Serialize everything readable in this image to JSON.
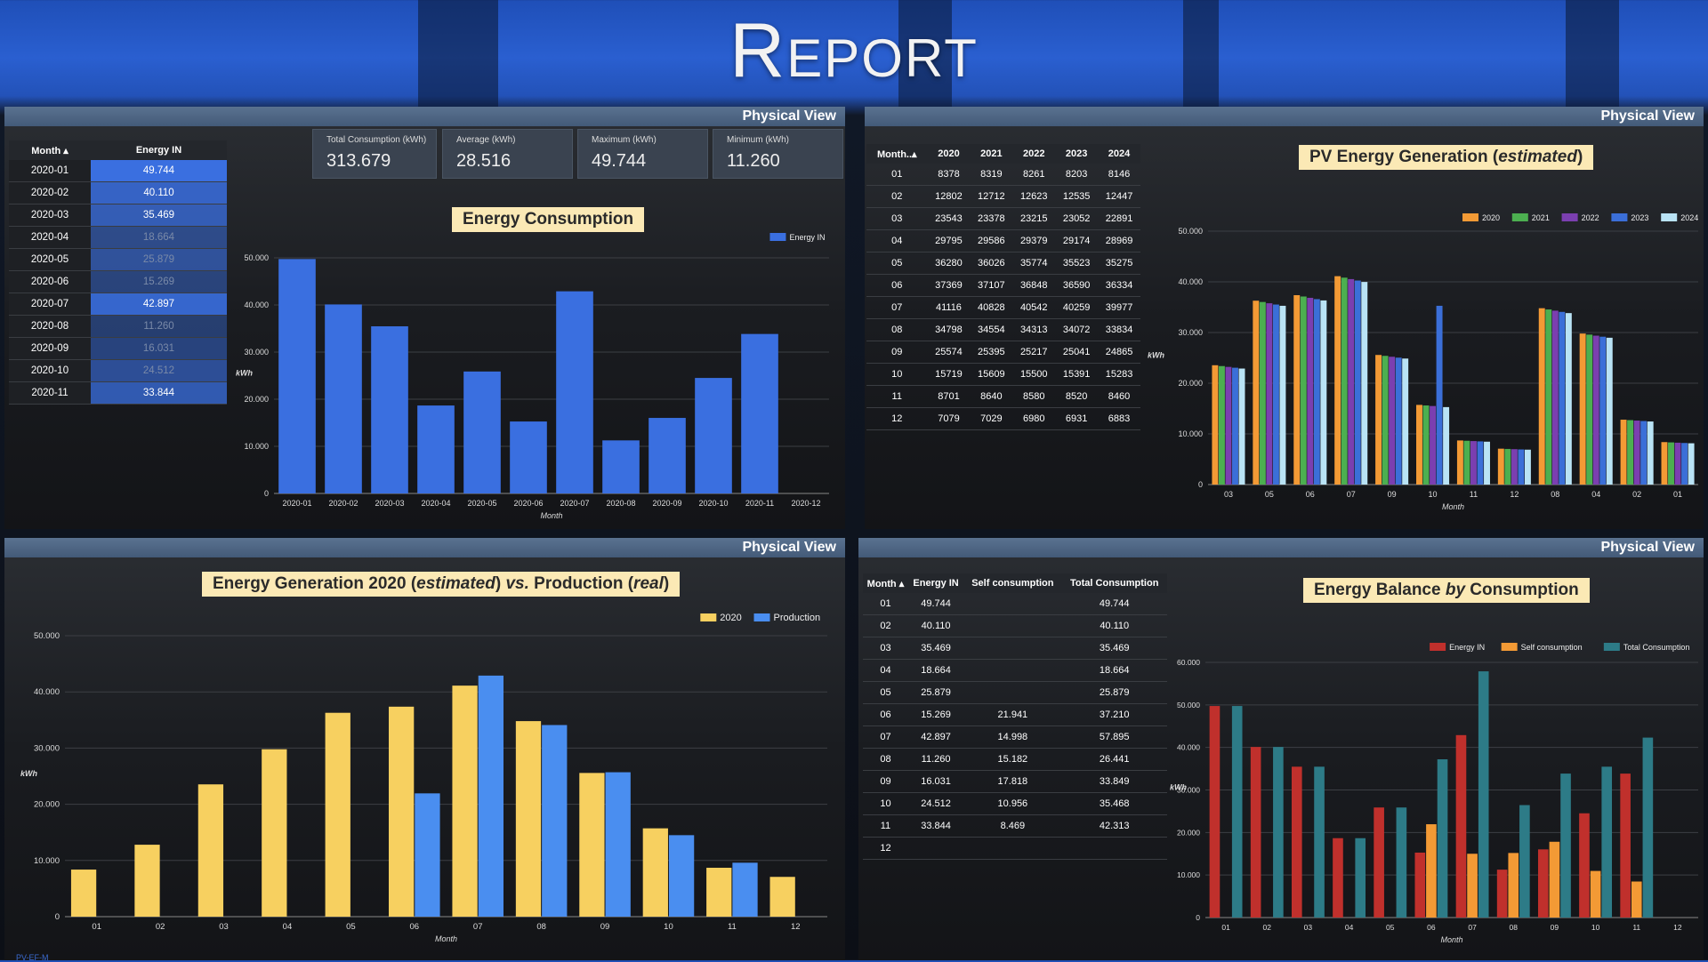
{
  "header": {
    "title": "Report"
  },
  "panel_label": "Physical View",
  "footnote": "PV-EF-M",
  "colors": {
    "accent_blue": "#3a6fe0",
    "yellow": "#f7d060",
    "red": "#c0302c",
    "orange": "#f39a35",
    "teal": "#2d7b87"
  },
  "panel1": {
    "table": {
      "headers": [
        "Month",
        "Energy IN"
      ],
      "rows": [
        {
          "month": "2020-01",
          "value": "49.744",
          "level": 0.995
        },
        {
          "month": "2020-02",
          "value": "40.110",
          "level": 0.8
        },
        {
          "month": "2020-03",
          "value": "35.469",
          "level": 0.7
        },
        {
          "month": "2020-04",
          "value": "18.664",
          "level": 0.37
        },
        {
          "month": "2020-05",
          "value": "25.879",
          "level": 0.5
        },
        {
          "month": "2020-06",
          "value": "15.269",
          "level": 0.3
        },
        {
          "month": "2020-07",
          "value": "42.897",
          "level": 0.86
        },
        {
          "month": "2020-08",
          "value": "11.260",
          "level": 0.22
        },
        {
          "month": "2020-09",
          "value": "16.031",
          "level": 0.32
        },
        {
          "month": "2020-10",
          "value": "24.512",
          "level": 0.49
        },
        {
          "month": "2020-11",
          "value": "33.844",
          "level": 0.68
        }
      ]
    },
    "scorecards": [
      {
        "label": "Total Consumption (kWh)",
        "value": "313.679"
      },
      {
        "label": "Average (kWh)",
        "value": "28.516"
      },
      {
        "label": "Maximum (kWh)",
        "value": "49.744"
      },
      {
        "label": "Minimum (kWh)",
        "value": "11.260"
      }
    ],
    "chart_title": "Energy Consumption"
  },
  "panel2": {
    "table": {
      "headers": [
        "Month",
        "2020",
        "2021",
        "2022",
        "2023",
        "2024"
      ],
      "rows": [
        [
          "01",
          "8378",
          "8319",
          "8261",
          "8203",
          "8146"
        ],
        [
          "02",
          "12802",
          "12712",
          "12623",
          "12535",
          "12447"
        ],
        [
          "03",
          "23543",
          "23378",
          "23215",
          "23052",
          "22891"
        ],
        [
          "04",
          "29795",
          "29586",
          "29379",
          "29174",
          "28969"
        ],
        [
          "05",
          "36280",
          "36026",
          "35774",
          "35523",
          "35275"
        ],
        [
          "06",
          "37369",
          "37107",
          "36848",
          "36590",
          "36334"
        ],
        [
          "07",
          "41116",
          "40828",
          "40542",
          "40259",
          "39977"
        ],
        [
          "08",
          "34798",
          "34554",
          "34313",
          "34072",
          "33834"
        ],
        [
          "09",
          "25574",
          "25395",
          "25217",
          "25041",
          "24865"
        ],
        [
          "10",
          "15719",
          "15609",
          "15500",
          "15391",
          "15283"
        ],
        [
          "11",
          "8701",
          "8640",
          "8580",
          "8520",
          "8460"
        ],
        [
          "12",
          "7079",
          "7029",
          "6980",
          "6931",
          "6883"
        ]
      ]
    },
    "chart_title_main": "PV Energy Generation (",
    "chart_title_em": "estimated",
    "chart_title_end": ")"
  },
  "panel3": {
    "chart_title_a": "Energy Generation 2020 (",
    "chart_title_em1": "estimated",
    "chart_title_b": ") ",
    "chart_title_vs": "vs.",
    "chart_title_c": " Production (",
    "chart_title_em2": "real",
    "chart_title_d": ")"
  },
  "panel4": {
    "table": {
      "headers": [
        "Month",
        "Energy IN",
        "Self consumption",
        "Total Consumption"
      ],
      "rows": [
        [
          "01",
          "49.744",
          "",
          "49.744"
        ],
        [
          "02",
          "40.110",
          "",
          "40.110"
        ],
        [
          "03",
          "35.469",
          "",
          "35.469"
        ],
        [
          "04",
          "18.664",
          "",
          "18.664"
        ],
        [
          "05",
          "25.879",
          "",
          "25.879"
        ],
        [
          "06",
          "15.269",
          "21.941",
          "37.210"
        ],
        [
          "07",
          "42.897",
          "14.998",
          "57.895"
        ],
        [
          "08",
          "11.260",
          "15.182",
          "26.441"
        ],
        [
          "09",
          "16.031",
          "17.818",
          "33.849"
        ],
        [
          "10",
          "24.512",
          "10.956",
          "35.468"
        ],
        [
          "11",
          "33.844",
          "8.469",
          "42.313"
        ],
        [
          "12",
          "",
          "",
          ""
        ]
      ]
    },
    "chart_title_a": "Energy Balance ",
    "chart_title_em": "by",
    "chart_title_b": " Consumption"
  },
  "chart_data": [
    {
      "type": "bar",
      "title": "Energy Consumption",
      "xlabel": "Month",
      "ylabel": "kWh",
      "ylim": [
        0,
        50000
      ],
      "yticks": [
        "0",
        "10.000",
        "20.000",
        "30.000",
        "40.000",
        "50.000"
      ],
      "categories": [
        "2020-01",
        "2020-02",
        "2020-03",
        "2020-04",
        "2020-05",
        "2020-06",
        "2020-07",
        "2020-08",
        "2020-09",
        "2020-10",
        "2020-11",
        "2020-12"
      ],
      "series": [
        {
          "name": "Energy IN",
          "color": "#3a6fe0",
          "values": [
            49744,
            40110,
            35469,
            18664,
            25879,
            15269,
            42897,
            11260,
            16031,
            24512,
            33844,
            null
          ]
        }
      ],
      "legend": "top-right",
      "grid": true
    },
    {
      "type": "bar",
      "title": "PV Energy Generation (estimated)",
      "xlabel": "Month",
      "ylabel": "kWh",
      "ylim": [
        0,
        50000
      ],
      "yticks": [
        "0",
        "10.000",
        "20.000",
        "30.000",
        "40.000",
        "50.000"
      ],
      "categories": [
        "03",
        "05",
        "06",
        "07",
        "09",
        "10",
        "11",
        "12",
        "08",
        "04",
        "02",
        "01"
      ],
      "series": [
        {
          "name": "2020",
          "color": "#f39a35",
          "values": [
            23543,
            36280,
            37369,
            41116,
            25574,
            15719,
            8701,
            7079,
            34798,
            29795,
            12802,
            8378
          ]
        },
        {
          "name": "2021",
          "color": "#4caf50",
          "values": [
            23378,
            36026,
            37107,
            40828,
            25395,
            15609,
            8640,
            7029,
            34554,
            29586,
            12712,
            8319
          ]
        },
        {
          "name": "2022",
          "color": "#7b3fb0",
          "values": [
            23215,
            35774,
            36848,
            40542,
            25217,
            15500,
            8580,
            6980,
            34313,
            29379,
            12623,
            8261
          ]
        },
        {
          "name": "2023",
          "color": "#3b6fd8",
          "values": [
            23052,
            35523,
            36590,
            40259,
            25041,
            35275,
            8520,
            6931,
            34072,
            29174,
            12535,
            8203
          ]
        },
        {
          "name": "2024",
          "color": "#b9e3f5",
          "values": [
            22891,
            35275,
            36334,
            39977,
            24865,
            15283,
            8460,
            6883,
            33834,
            28969,
            12447,
            8146
          ]
        }
      ],
      "legend": "top-right",
      "grid": true
    },
    {
      "type": "bar",
      "title": "Energy Generation 2020 (estimated) vs. Production (real)",
      "xlabel": "Month",
      "ylabel": "kWh",
      "ylim": [
        0,
        50000
      ],
      "yticks": [
        "0",
        "10.000",
        "20.000",
        "30.000",
        "40.000",
        "50.000"
      ],
      "categories": [
        "01",
        "02",
        "03",
        "04",
        "05",
        "06",
        "07",
        "08",
        "09",
        "10",
        "11",
        "12"
      ],
      "series": [
        {
          "name": "2020",
          "color": "#f7d060",
          "values": [
            8378,
            12802,
            23543,
            29795,
            36280,
            37369,
            41116,
            34798,
            25574,
            15719,
            8701,
            7079
          ]
        },
        {
          "name": "Production",
          "color": "#4a8ef0",
          "values": [
            null,
            null,
            null,
            null,
            null,
            21941,
            42900,
            34100,
            25700,
            14500,
            9600,
            null
          ]
        }
      ],
      "legend": "top-right",
      "grid": true
    },
    {
      "type": "bar",
      "title": "Energy Balance by Consumption",
      "xlabel": "Month",
      "ylabel": "kWh",
      "ylim": [
        0,
        60000
      ],
      "yticks": [
        "0",
        "10.000",
        "20.000",
        "30.000",
        "40.000",
        "50.000",
        "60.000"
      ],
      "categories": [
        "01",
        "02",
        "03",
        "04",
        "05",
        "06",
        "07",
        "08",
        "09",
        "10",
        "11",
        "12"
      ],
      "series": [
        {
          "name": "Energy IN",
          "color": "#c0302c",
          "values": [
            49744,
            40110,
            35469,
            18664,
            25879,
            15269,
            42897,
            11260,
            16031,
            24512,
            33844,
            null
          ]
        },
        {
          "name": "Self consumption",
          "color": "#f39a35",
          "values": [
            null,
            null,
            null,
            null,
            null,
            21941,
            14998,
            15182,
            17818,
            10956,
            8469,
            null
          ]
        },
        {
          "name": "Total Consumption",
          "color": "#2d7b87",
          "values": [
            49744,
            40110,
            35469,
            18664,
            25879,
            37210,
            57895,
            26441,
            33849,
            35468,
            42313,
            null
          ]
        }
      ],
      "legend": "top-right",
      "grid": true
    }
  ]
}
